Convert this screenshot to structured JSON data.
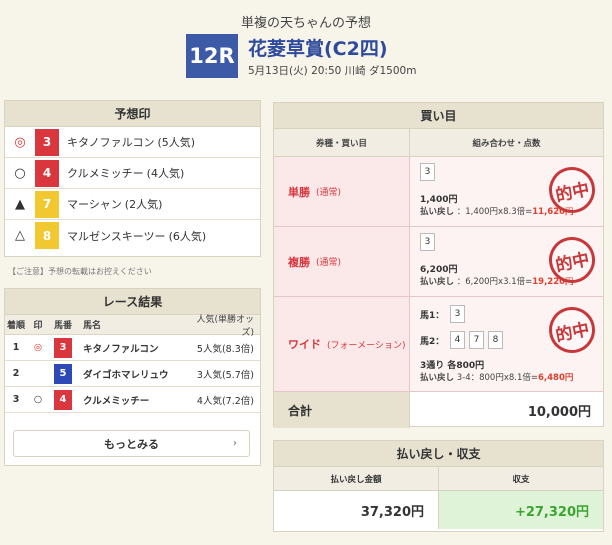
{
  "header": {
    "subtitle": "単複の天ちゃんの予想",
    "race_number": "12R",
    "race_name": "花菱草賞(C2四)",
    "race_info": "5月13日(火) 20:50 川崎 ダ1500m"
  },
  "prediction": {
    "title": "予想印",
    "rows": [
      {
        "mark": "◎",
        "num": "3",
        "name": "キタノファルコン",
        "pop": "(5人気)"
      },
      {
        "mark": "○",
        "num": "4",
        "name": "クルメミッチー",
        "pop": "(4人気)"
      },
      {
        "mark": "▲",
        "num": "7",
        "name": "マーシャン",
        "pop": "(2人気)"
      },
      {
        "mark": "△",
        "num": "8",
        "name": "マルゼンスキーツー",
        "pop": "(6人気)"
      }
    ],
    "notice": "【ご注意】予想の転載はお控えください"
  },
  "results": {
    "title": "レース結果",
    "headers": {
      "rank": "着順",
      "mark": "印",
      "num": "馬番",
      "name": "馬名",
      "pop": "人気(単勝オッズ)"
    },
    "rows": [
      {
        "rank": "1",
        "mark": "◎",
        "num": "3",
        "name": "キタノファルコン",
        "pop": "5人気(8.3倍)"
      },
      {
        "rank": "2",
        "mark": "",
        "num": "5",
        "name": "ダイゴホマレリュウ",
        "pop": "3人気(5.7倍)"
      },
      {
        "rank": "3",
        "mark": "○",
        "num": "4",
        "name": "クルメミッチー",
        "pop": "4人気(7.2倍)"
      }
    ],
    "more_label": "もっとみる",
    "more_chevron": "›"
  },
  "bets": {
    "title": "買い目",
    "headers": {
      "type": "券種・買い目",
      "combo": "組み合わせ・点数"
    },
    "tansho": {
      "type": "単勝",
      "sub": "(通常)",
      "box": "3",
      "amount": "1,400円",
      "pay_label": "払い戻し",
      "pay_calc": "：1,400円x8.3倍=",
      "pay_result": "11,620円"
    },
    "fukusho": {
      "type": "複勝",
      "sub": "(通常)",
      "box": "3",
      "amount": "6,200円",
      "pay_label": "払い戻し",
      "pay_calc": "：6,200円x3.1倍=",
      "pay_result": "19,220円"
    },
    "wide": {
      "type": "ワイド",
      "sub": "(フォーメーション)",
      "horse1_label": "馬1：",
      "horse1": [
        "3"
      ],
      "horse2_label": "馬2：",
      "horse2": [
        "4",
        "7",
        "8"
      ],
      "amount": "3通り 各800円",
      "pay_label": "払い戻し",
      "pay_calc": "3-4：800円x8.1倍=",
      "pay_result": "6,480円"
    },
    "stamp_text": "的中",
    "total_label": "合計",
    "total_value": "10,000円"
  },
  "payout": {
    "title": "払い戻し・収支",
    "back_label": "払い戻し金額",
    "profit_label": "収支",
    "back_value": "37,320円",
    "profit_value": "+27,320円"
  },
  "colors": {
    "accent": "#3d5aa6",
    "hit": "#d9363e",
    "profit": "#3aa52f"
  }
}
